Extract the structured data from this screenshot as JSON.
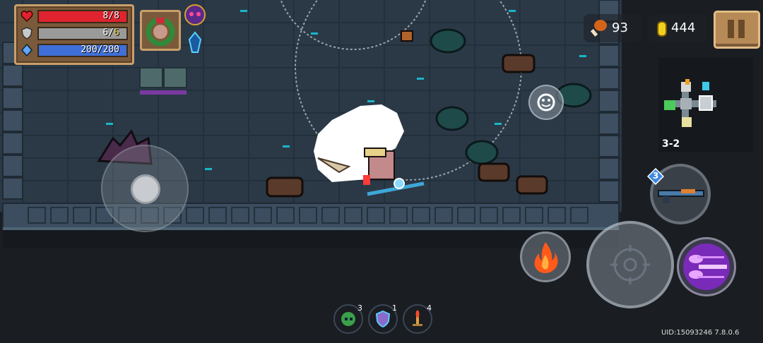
{
  "hud": {
    "health": {
      "label": "8/8",
      "fraction": 1.0,
      "color": "#e0242f"
    },
    "armor": {
      "label_current": "6",
      "label_sep": "/",
      "label_max": "6",
      "fraction": 1.0,
      "color": "#9a9a9a"
    },
    "energy": {
      "label": "200/200",
      "fraction": 1.0,
      "color": "#3f6fd8"
    }
  },
  "resources": {
    "meat_count": "93",
    "gold_count": "444"
  },
  "minimap": {
    "level_label": "3-2"
  },
  "weapon": {
    "energy_cost": "3"
  },
  "skills": [
    {
      "name": "green-skull-skill-icon",
      "count": "3"
    },
    {
      "name": "shield-buff-skill-icon",
      "count": "1"
    },
    {
      "name": "fire-sword-skill-icon",
      "count": "4"
    }
  ],
  "footer": {
    "uid_text": "UID:15093246 7.8.0.6"
  },
  "colors": {
    "floor": "#2a3845",
    "wall": "#46586a",
    "accent_cyan": "#19b6c7",
    "panel_brown": "#7a5a3a",
    "panel_border": "#c9a06a"
  }
}
